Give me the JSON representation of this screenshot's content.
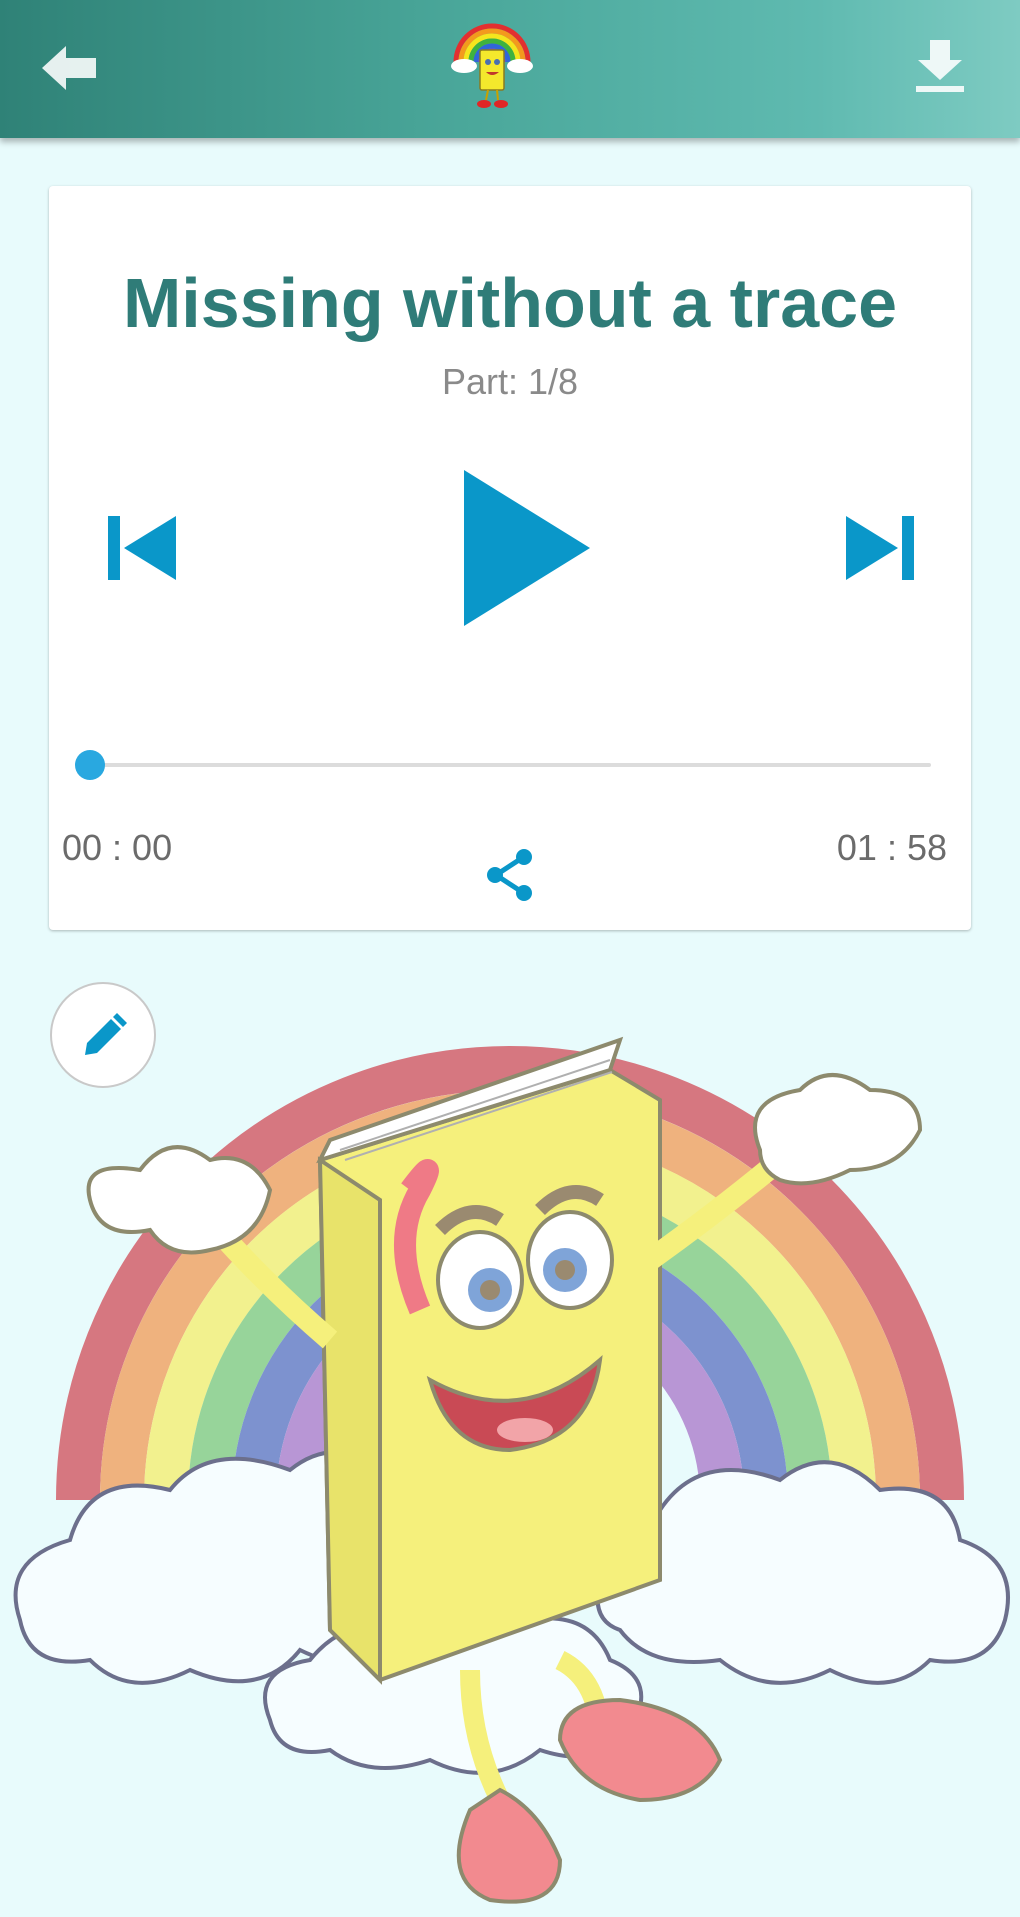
{
  "header": {
    "back_icon": "arrow-left-icon",
    "logo_icon": "rainbow-book-logo",
    "download_icon": "download-icon",
    "background_gradient": [
      "#2f8277",
      "#7ecbc2"
    ]
  },
  "player": {
    "title": "Missing without a trace",
    "part": "Part: 1/8",
    "current_time": "00 : 00",
    "total_time": "01 : 58",
    "progress": 0,
    "prev_icon": "skip-previous-icon",
    "play_icon": "play-icon",
    "next_icon": "skip-next-icon",
    "share_icon": "share-icon",
    "accent_color": "#0a97c9",
    "title_color": "#2f7c78"
  },
  "edit": {
    "icon": "pencil-icon"
  },
  "illustration": {
    "subject": "book-mascot-on-rainbow"
  }
}
